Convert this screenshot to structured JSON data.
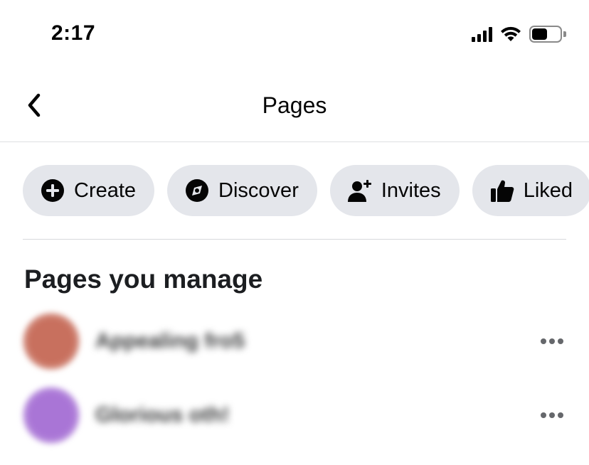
{
  "status_bar": {
    "time": "2:17",
    "signal_bars": 4,
    "battery_level": 0.55
  },
  "header": {
    "title": "Pages",
    "back_icon": "chevron-left-icon"
  },
  "chips": [
    {
      "label": "Create",
      "icon": "plus-circle-icon"
    },
    {
      "label": "Discover",
      "icon": "compass-icon"
    },
    {
      "label": "Invites",
      "icon": "person-add-icon"
    },
    {
      "label": "Liked",
      "icon": "thumbs-up-icon"
    }
  ],
  "section": {
    "title": "Pages you manage"
  },
  "pages": [
    {
      "name": "Appealing fro5",
      "avatar_color": "#c8705e"
    },
    {
      "name": "Glorious oth!",
      "avatar_color": "#a975d6"
    }
  ],
  "colors": {
    "chip_bg": "#e4e6eb",
    "text_primary": "#050505",
    "text_secondary": "#65676b"
  }
}
